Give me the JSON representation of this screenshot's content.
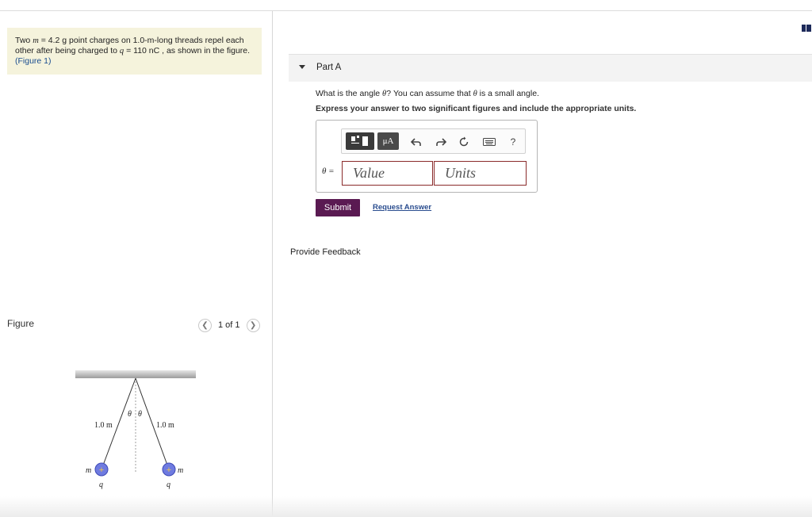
{
  "problem": {
    "line1_a": "Two ",
    "line1_m": "m",
    "line1_b": " = 4.2 g point charges on 1.0-m-long threads repel each",
    "line2_a": "other after being charged to ",
    "line2_q": "q",
    "line2_b": " = 110 nC , as shown in the figure.",
    "figure_link": "(Figure 1)"
  },
  "figure": {
    "label": "Figure",
    "pager_text": "1 of 1",
    "prev_icon": "chevron-left-icon",
    "next_icon": "chevron-right-icon",
    "thread_left_label": "1.0 m",
    "thread_right_label": "1.0 m",
    "theta_left": "θ",
    "theta_right": "θ",
    "mass_left": "m",
    "mass_right": "m",
    "charge_left": "q",
    "charge_right": "q",
    "charge_sign": "+"
  },
  "part_a": {
    "title": "Part A",
    "question_a": "What is the angle ",
    "question_theta": "θ",
    "question_b": "? You can assume that ",
    "question_theta2": "θ",
    "question_c": " is a small angle.",
    "instruction": "Express your answer to two significant figures and include the appropriate units.",
    "toolbar": {
      "mu_label": "μA",
      "undo_icon": "undo-icon",
      "redo_icon": "redo-icon",
      "reset_icon": "reset-icon",
      "keyboard_icon": "keyboard-icon",
      "help_label": "?"
    },
    "answer_label": "θ =",
    "value_placeholder": "Value",
    "units_placeholder": "Units",
    "submit_label": "Submit",
    "request_answer_label": "Request Answer"
  },
  "feedback_label": "Provide Feedback",
  "colors": {
    "problem_bg": "#f5f3dc",
    "submit_bg": "#5a1a52",
    "input_border": "#8a2b2b",
    "charge_fill": "#6f7be0"
  }
}
